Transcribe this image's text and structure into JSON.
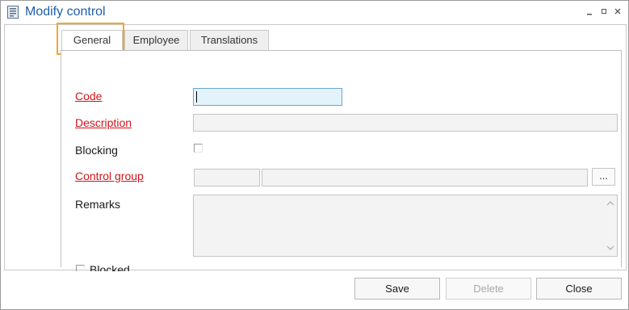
{
  "window": {
    "title": "Modify control",
    "accent_color": "#1f5fa8"
  },
  "tabs": [
    {
      "label": "General",
      "active": true
    },
    {
      "label": "Employee",
      "active": false
    },
    {
      "label": "Translations",
      "active": false
    }
  ],
  "form": {
    "code_label": "Code",
    "code_value": "",
    "description_label": "Description",
    "description_value": "",
    "blocking_label": "Blocking",
    "blocking_checked": false,
    "control_group_label": "Control group",
    "control_group_code": "",
    "control_group_name": "",
    "lookup_label": "...",
    "remarks_label": "Remarks",
    "remarks_value": "",
    "blocked_label": "Blocked",
    "blocked_checked": false,
    "required_color": "#d0141c"
  },
  "buttons": {
    "save": "Save",
    "delete": "Delete",
    "close": "Close"
  }
}
